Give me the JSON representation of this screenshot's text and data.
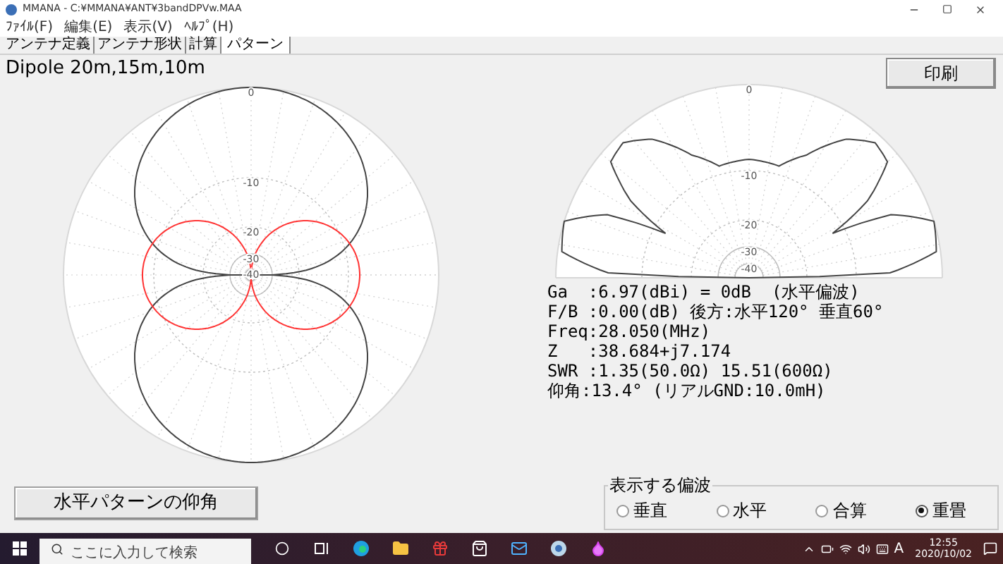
{
  "window": {
    "title": "MMANA - C:¥MMANA¥ANT¥3bandDPVw.MAA"
  },
  "menu": [
    "ﾌｧｲﾙ(F)",
    "編集(E)",
    "表示(V)",
    "ﾍﾙﾌﾟ(H)"
  ],
  "tabs": [
    {
      "label": "アンテナ定義",
      "selected": false
    },
    {
      "label": "アンテナ形状",
      "selected": false
    },
    {
      "label": "計算",
      "selected": false
    },
    {
      "label": "パターン",
      "selected": true
    }
  ],
  "heading": "Dipole 20m,15m,10m",
  "print_button": "印刷",
  "horizontal_pattern": {
    "ring_labels": [
      "0",
      "-10",
      "-20",
      "-30",
      "-40"
    ]
  },
  "vertical_pattern": {
    "ring_labels": [
      "0",
      "-10",
      "-20",
      "-30",
      "-40"
    ]
  },
  "results": [
    "Ga  :6.97(dBi) = 0dB  (水平偏波)",
    "F/B :0.00(dB) 後方:水平120° 垂直60°",
    "Freq:28.050(MHz)",
    "Z   :38.684+j7.174",
    "SWR :1.35(50.0Ω) 15.51(600Ω)",
    "仰角:13.4° (リアルGND:10.0mH)"
  ],
  "elevation_button": "水平パターンの仰角",
  "polarization": {
    "title": "表示する偏波",
    "options": [
      {
        "label": "垂直",
        "selected": false
      },
      {
        "label": "水平",
        "selected": false
      },
      {
        "label": "合算",
        "selected": false
      },
      {
        "label": "重畳",
        "selected": true
      }
    ]
  },
  "taskbar": {
    "search": {
      "placeholder": "ここに入力して検索"
    },
    "ime": "A",
    "time": "12:55",
    "date": "2020/10/02"
  }
}
